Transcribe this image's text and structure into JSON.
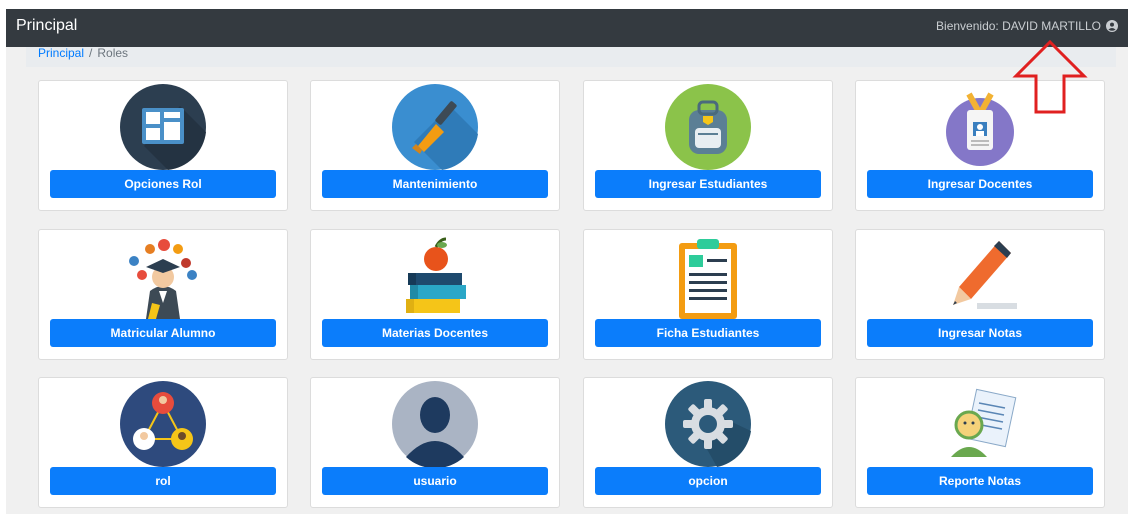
{
  "navbar": {
    "brand": "Principal",
    "welcome": "Bienvenido: DAVID MARTILLO"
  },
  "breadcrumb": {
    "home": "Principal",
    "separator": "/",
    "current": "Roles"
  },
  "modules": [
    {
      "label": "Opciones Rol",
      "icon": "dashboard-layout-icon"
    },
    {
      "label": "Mantenimiento",
      "icon": "screwdriver-icon"
    },
    {
      "label": "Ingresar Estudiantes",
      "icon": "backpack-icon"
    },
    {
      "label": "Ingresar Docentes",
      "icon": "id-badge-icon"
    },
    {
      "label": "Matricular Alumno",
      "icon": "graduate-icon"
    },
    {
      "label": "Materias Docentes",
      "icon": "books-apple-icon"
    },
    {
      "label": "Ficha Estudiantes",
      "icon": "clipboard-icon"
    },
    {
      "label": "Ingresar Notas",
      "icon": "pencil-icon"
    },
    {
      "label": "rol",
      "icon": "people-network-icon"
    },
    {
      "label": "usuario",
      "icon": "user-silhouette-icon"
    },
    {
      "label": "opcion",
      "icon": "gear-icon"
    },
    {
      "label": "Reporte Notas",
      "icon": "report-card-icon"
    }
  ],
  "colors": {
    "navbar": "#343a40",
    "button": "#0b7dfb",
    "annotation_arrow": "#e02020"
  }
}
